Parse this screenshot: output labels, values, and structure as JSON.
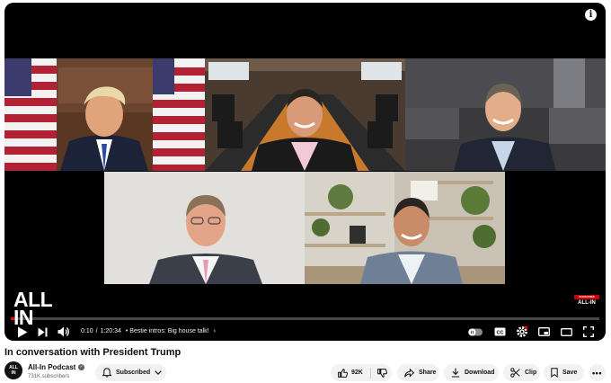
{
  "player": {
    "watermark_top": "ALL",
    "watermark_bottom": "IN",
    "subscribe_badge": "SUBSCRIBE",
    "corner_brand": "ALL-IN",
    "current_time": "0:10",
    "separator": "/",
    "duration": "1:20:34",
    "chapter": "Bestie intros: Big house talk!",
    "progress_fraction": 0.002,
    "accent_color": "#ff0000"
  },
  "video": {
    "title": "In conversation with President Trump"
  },
  "channel": {
    "name": "All-In Podcast",
    "subscribers": "731K subscribers",
    "avatar_top": "ALL",
    "avatar_bottom": "IN"
  },
  "actions": {
    "subscribed_label": "Subscribed",
    "like_count": "92K",
    "share_label": "Share",
    "download_label": "Download",
    "clip_label": "Clip",
    "save_label": "Save",
    "more_label": "•••"
  }
}
